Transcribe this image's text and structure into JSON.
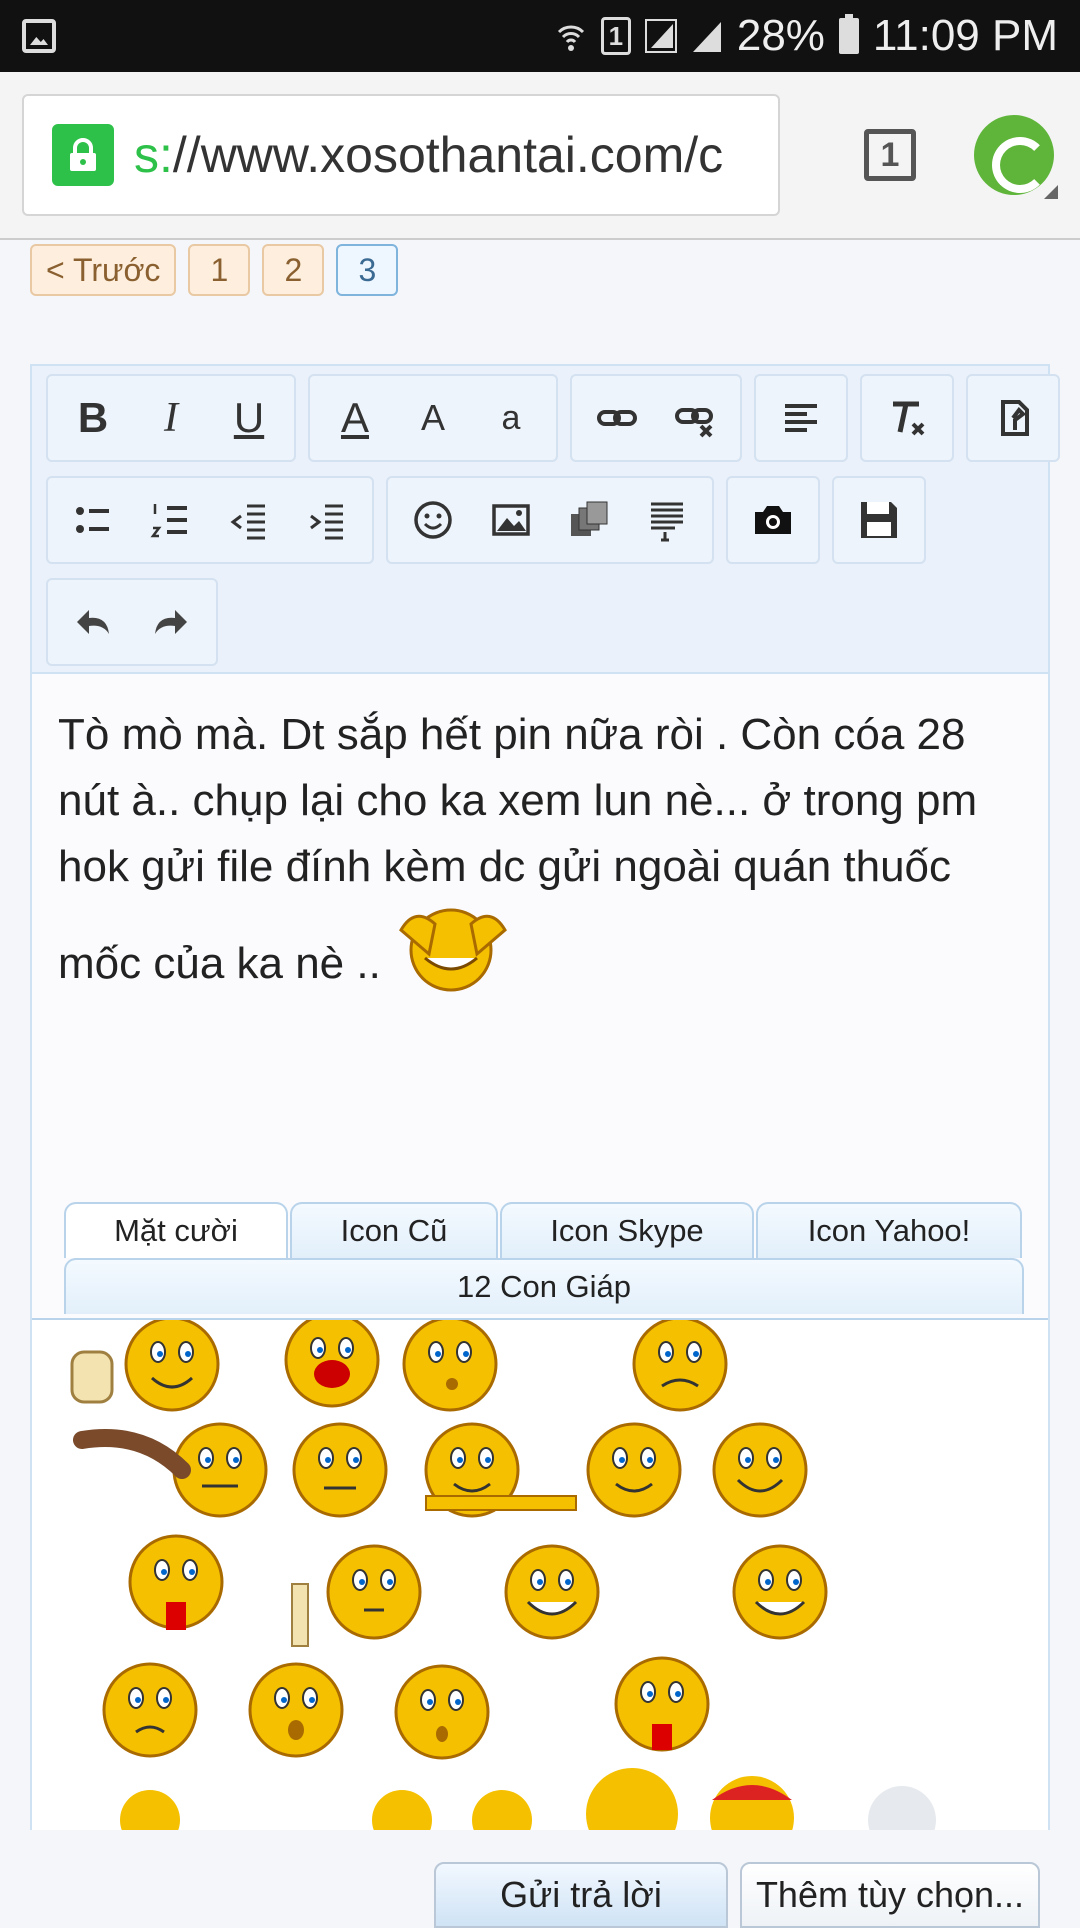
{
  "status_bar": {
    "battery": "28%",
    "time": "11:09 PM",
    "sim_slot": "1"
  },
  "browser": {
    "url": "s://www.xosothantai.com/c",
    "url_scheme_part": "s:",
    "url_rest": "//www.xosothantai.com/c",
    "tab_count": "1"
  },
  "pager": {
    "prev": "< Trước",
    "pages": [
      "1",
      "2",
      "3"
    ],
    "active_page": "3"
  },
  "toolbar": {
    "bold": "B",
    "italic": "I",
    "underline": "U",
    "font_color": "A",
    "font_size": "A",
    "font_family": "a"
  },
  "editor": {
    "text": "Tò mò mà. Dt sắp hết pin nữa ròi . Còn cóa 28 nút à.. chụp lại cho ka xem lun nè... ở trong pm hok gửi file đính kèm dc  gửi ngoài quán thuốc mốc của ka nè .."
  },
  "emoticon_tabs": {
    "row1": [
      "Mặt cười",
      "Icon Cũ",
      "Icon Skype",
      "Icon Yahoo!"
    ],
    "row2": "12 Con Giáp",
    "active": "Mặt cười"
  },
  "footer": {
    "submit": "Gửi trả lời",
    "more_options": "Thêm tùy chọn..."
  },
  "colors": {
    "accent_green": "#2ec14a",
    "smiley_yellow": "#f5c000",
    "toolbar_bg": "#eaf1fa"
  }
}
